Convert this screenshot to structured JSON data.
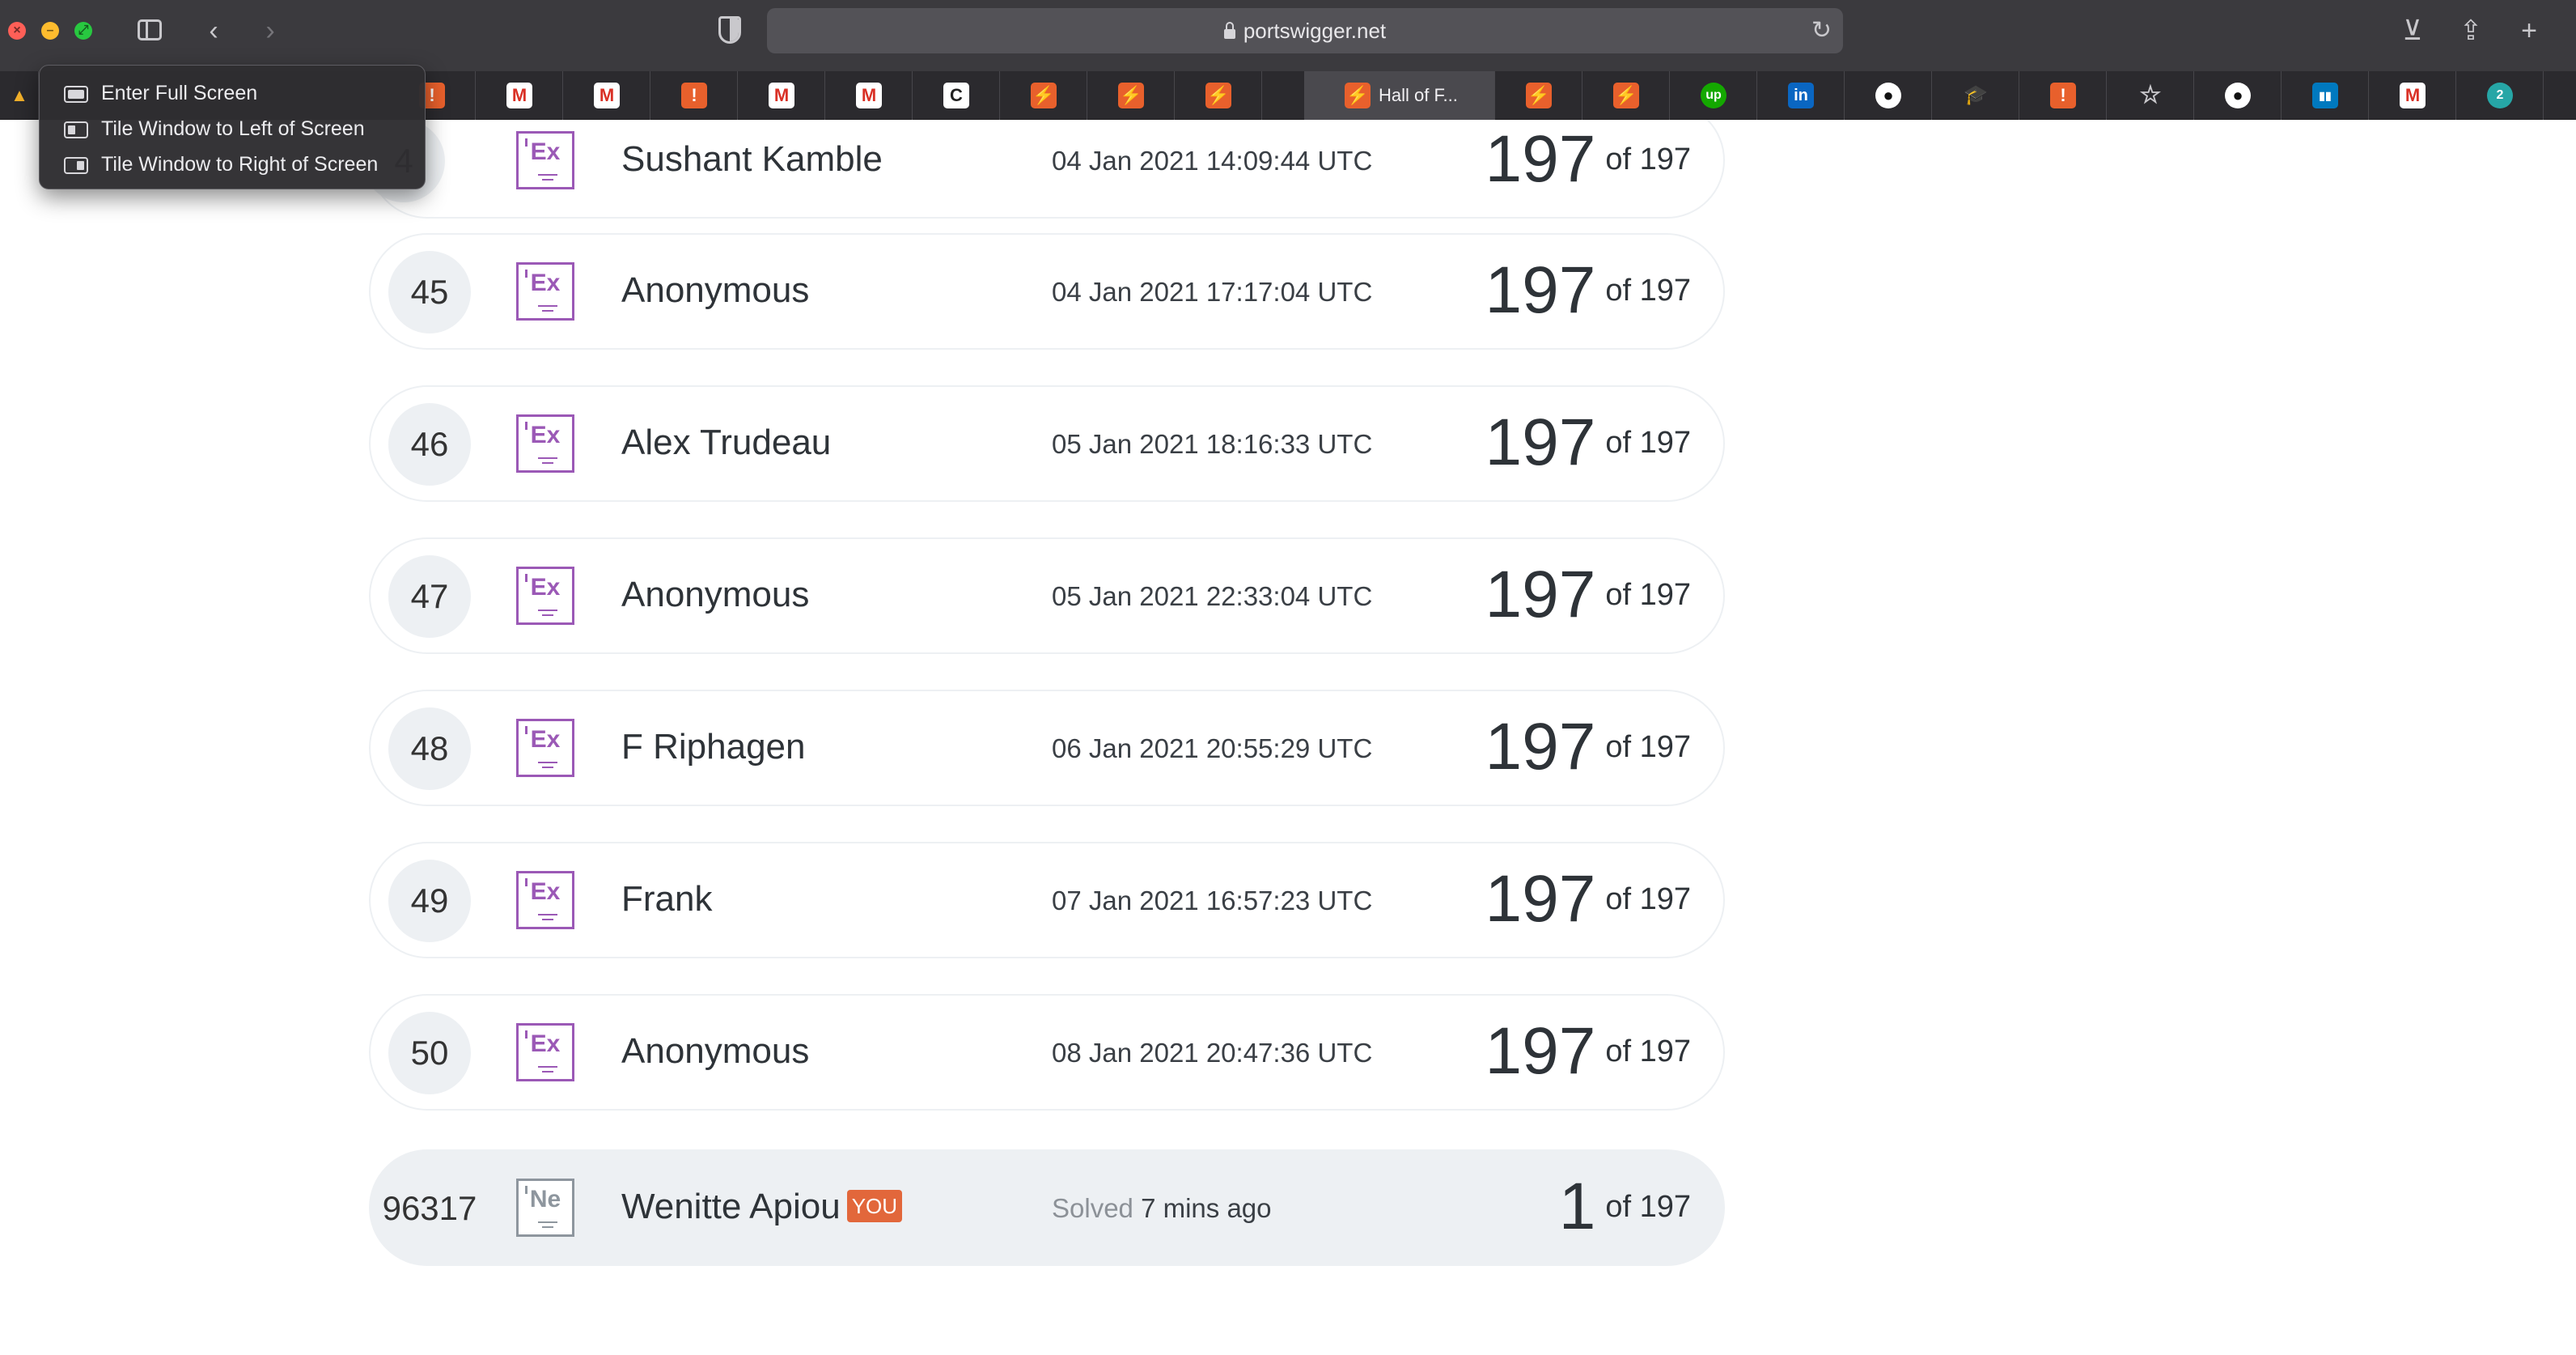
{
  "browser": {
    "url": "portswigger.net",
    "active_tab_title": "Hall of F...",
    "tabs": [
      {
        "icon": "warning-icon",
        "color": "#e8602c",
        "glyph": "!"
      },
      {
        "icon": "gmail-icon",
        "color": "#ffffff",
        "glyph": "M"
      },
      {
        "icon": "gmail-icon",
        "color": "#ffffff",
        "glyph": "M"
      },
      {
        "icon": "warning-icon",
        "color": "#e8602c",
        "glyph": "!"
      },
      {
        "icon": "gmail-icon",
        "color": "#ffffff",
        "glyph": "M"
      },
      {
        "icon": "gmail-icon",
        "color": "#ffffff",
        "glyph": "M"
      },
      {
        "icon": "c-logo-icon",
        "color": "#ffffff",
        "glyph": "C"
      },
      {
        "icon": "portswigger-icon",
        "color": "#e8602c",
        "glyph": "⚡"
      },
      {
        "icon": "portswigger-icon",
        "color": "#e8602c",
        "glyph": "⚡"
      },
      {
        "icon": "portswigger-icon",
        "color": "#e8602c",
        "glyph": "⚡"
      }
    ],
    "tabs_right": [
      {
        "icon": "portswigger-icon",
        "color": "#e8602c",
        "glyph": "⚡"
      },
      {
        "icon": "portswigger-icon",
        "color": "#e8602c",
        "glyph": "⚡"
      },
      {
        "icon": "upwork-icon",
        "color": "#14a800",
        "glyph": "up"
      },
      {
        "icon": "linkedin-icon",
        "color": "#0a66c2",
        "glyph": "in"
      },
      {
        "icon": "github-icon",
        "color": "#ffffff",
        "glyph": "●"
      },
      {
        "icon": "graduation-cap-icon",
        "color": "#4aa3df",
        "glyph": "🎓"
      },
      {
        "icon": "warning-icon",
        "color": "#e8602c",
        "glyph": "!"
      },
      {
        "icon": "star-icon",
        "color": "#2b2a2e",
        "glyph": "☆"
      },
      {
        "icon": "github-icon",
        "color": "#ffffff",
        "glyph": "●"
      },
      {
        "icon": "trello-icon",
        "color": "#0079bf",
        "glyph": "▮▮"
      },
      {
        "icon": "gmail-icon",
        "color": "#ffffff",
        "glyph": "M"
      },
      {
        "icon": "zapier-icon",
        "color": "#26a6a6",
        "glyph": "2"
      }
    ]
  },
  "window_menu": {
    "items": [
      {
        "label": "Enter Full Screen",
        "icon": "full-screen-icon"
      },
      {
        "label": "Tile Window to Left of Screen",
        "icon": "tile-left-icon"
      },
      {
        "label": "Tile Window to Right of Screen",
        "icon": "tile-right-icon"
      }
    ]
  },
  "leaderboard": {
    "rows": [
      {
        "rank": "44",
        "rank_shown": "4",
        "badge": "Ex",
        "name": "Sushant Kamble",
        "date": "04 Jan 2021 14:09:44 UTC",
        "score": "197",
        "total": "of 197"
      },
      {
        "rank": "45",
        "badge": "Ex",
        "name": "Anonymous",
        "date": "04 Jan 2021 17:17:04 UTC",
        "score": "197",
        "total": "of 197"
      },
      {
        "rank": "46",
        "badge": "Ex",
        "name": "Alex Trudeau",
        "date": "05 Jan 2021 18:16:33 UTC",
        "score": "197",
        "total": "of 197"
      },
      {
        "rank": "47",
        "badge": "Ex",
        "name": "Anonymous",
        "date": "05 Jan 2021 22:33:04 UTC",
        "score": "197",
        "total": "of 197"
      },
      {
        "rank": "48",
        "badge": "Ex",
        "name": "F Riphagen",
        "date": "06 Jan 2021 20:55:29 UTC",
        "score": "197",
        "total": "of 197"
      },
      {
        "rank": "49",
        "badge": "Ex",
        "name": "Frank",
        "date": "07 Jan 2021 16:57:23 UTC",
        "score": "197",
        "total": "of 197"
      },
      {
        "rank": "50",
        "badge": "Ex",
        "name": "Anonymous",
        "date": "08 Jan 2021 20:47:36 UTC",
        "score": "197",
        "total": "of 197"
      }
    ],
    "you": {
      "rank": "96317",
      "badge": "Ne",
      "name": "Wenitte Apiou",
      "tag": "YOU",
      "solved_label": "Solved",
      "solved_time": "7 mins ago",
      "score": "1",
      "total": "of 197"
    },
    "colors": {
      "expert": "#9b59b6",
      "novice": "#8e969e",
      "you_tag": "#e2673b"
    }
  }
}
